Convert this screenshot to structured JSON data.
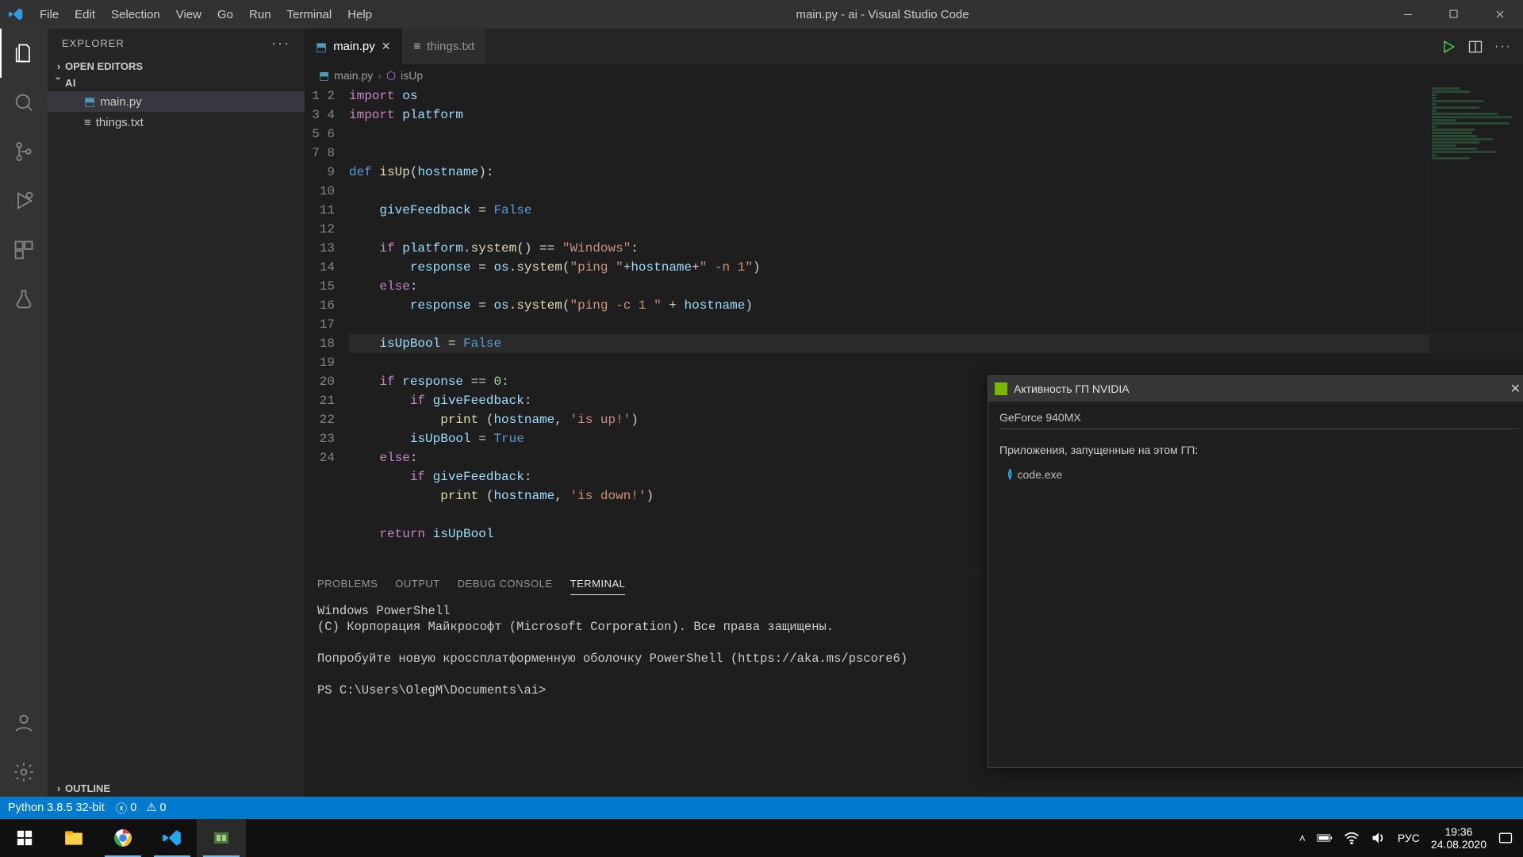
{
  "window": {
    "title": "main.py - ai - Visual Studio Code"
  },
  "menu": {
    "file": "File",
    "edit": "Edit",
    "selection": "Selection",
    "view": "View",
    "go": "Go",
    "run": "Run",
    "terminal": "Terminal",
    "help": "Help"
  },
  "explorer": {
    "title": "EXPLORER",
    "open_editors": "OPEN EDITORS",
    "folder": "AI",
    "files": {
      "main": "main.py",
      "things": "things.txt"
    },
    "outline": "OUTLINE"
  },
  "tabs": {
    "main": "main.py",
    "things": "things.txt"
  },
  "breadcrumb": {
    "file": "main.py",
    "symbol": "isUp"
  },
  "code": {
    "first_line": 1,
    "last_line": 24
  },
  "panel": {
    "problems": "PROBLEMS",
    "output": "OUTPUT",
    "debug_console": "DEBUG CONSOLE",
    "terminal": "TERMINAL",
    "terminal_text": "Windows PowerShell\n(C) Корпорация Майкрософт (Microsoft Corporation). Все права защищены.\n\nПопробуйте новую кроссплатформенную оболочку PowerShell (https://aka.ms/pscore6)\n\nPS C:\\Users\\OlegM\\Documents\\ai> "
  },
  "statusbar": {
    "python": "Python 3.8.5 32-bit",
    "errors": "0",
    "warnings": "0"
  },
  "nvidia": {
    "title": "Активность ГП NVIDIA",
    "gpu": "GeForce 940MX",
    "apps_label": "Приложения, запущенные на этом ГП:",
    "app": "code.exe"
  },
  "taskbar": {
    "lang": "РУС",
    "time": "19:36",
    "date": "24.08.2020"
  }
}
